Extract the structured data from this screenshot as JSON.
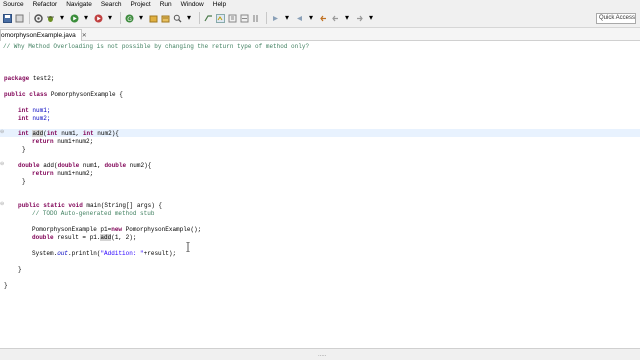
{
  "menu": [
    "Source",
    "Refactor",
    "Navigate",
    "Search",
    "Project",
    "Run",
    "Window",
    "Help"
  ],
  "toolbar": {
    "icons": [
      "save-icon",
      "properties-icon",
      "build-icon",
      "debug-icon",
      "run-icon",
      "coverage-icon",
      "new-java-class-icon",
      "new-package-icon",
      "open-type-icon",
      "search-icon",
      "toggle-breadcrumb-icon",
      "mark-occurrences-icon",
      "show-whitespace-icon",
      "next-annotation-icon",
      "prev-annotation-icon",
      "last-edit-icon",
      "back-icon",
      "forward-icon"
    ],
    "quick_access": "Quick Access"
  },
  "tab": {
    "label": "omorphysonExample.java",
    "close": "✕"
  },
  "code": {
    "comment_top": "// Why Method Overloading is not possible by changing the return type of method only?",
    "pkg_kw": "package",
    "pkg_name": " test2;",
    "class_kw": "public class",
    "class_name": " PomorphysonExample {",
    "int_kw": "int",
    "num1_decl": " num1;",
    "num2_decl": " num2;",
    "add_int_kw1": "int",
    "add_name": "add",
    "add_params_a": "(",
    "add_params_int1": "int",
    "add_params_b": " num1, ",
    "add_params_int2": "int",
    "add_params_c": " num2){",
    "return_kw": "return",
    "return_expr": " num1+num2;",
    "close_brace": "}",
    "double_kw": "double",
    "add_double_rest_a": " add(",
    "add_double_rest_b": " num1, ",
    "add_double_rest_c": " num2){",
    "main_kw": "public static void",
    "main_rest": " main(String[] args) {",
    "todo_comment": "// TODO Auto-generated method stub",
    "new_stmt_a": "PomorphysonExample p1=",
    "new_kw": "new",
    "new_stmt_b": " PomorphysonExample();",
    "result_kw": "double",
    "result_a": " result = p1.",
    "result_add": "add",
    "result_b": "(1, 2);",
    "print_a": "System.",
    "print_out": "out",
    "print_b": ".println(",
    "print_str": "\"Addition: \"",
    "print_c": "+result);"
  },
  "status": {
    "dots": "....."
  }
}
